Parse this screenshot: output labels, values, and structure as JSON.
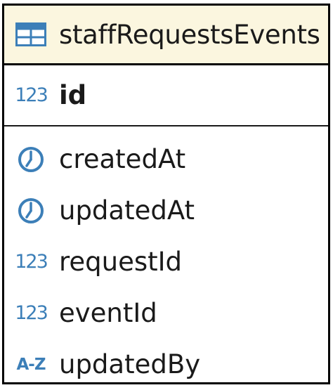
{
  "entity": {
    "name": "staffRequestsEvents",
    "icon": "table-icon",
    "primary_key": {
      "name": "id",
      "type_glyph": "123",
      "type_icon": "numeric-type-icon"
    },
    "fields": [
      {
        "name": "createdAt",
        "type_icon": "clock-icon"
      },
      {
        "name": "updatedAt",
        "type_icon": "clock-icon"
      },
      {
        "name": "requestId",
        "type_icon": "numeric-type-icon",
        "type_glyph": "123"
      },
      {
        "name": "eventId",
        "type_icon": "numeric-type-icon",
        "type_glyph": "123"
      },
      {
        "name": "updatedBy",
        "type_icon": "text-type-icon",
        "type_glyph": "A-Z"
      }
    ]
  },
  "colors": {
    "header_background": "#fbf6df",
    "icon_blue": "#3c7fb8",
    "border": "#000000"
  }
}
